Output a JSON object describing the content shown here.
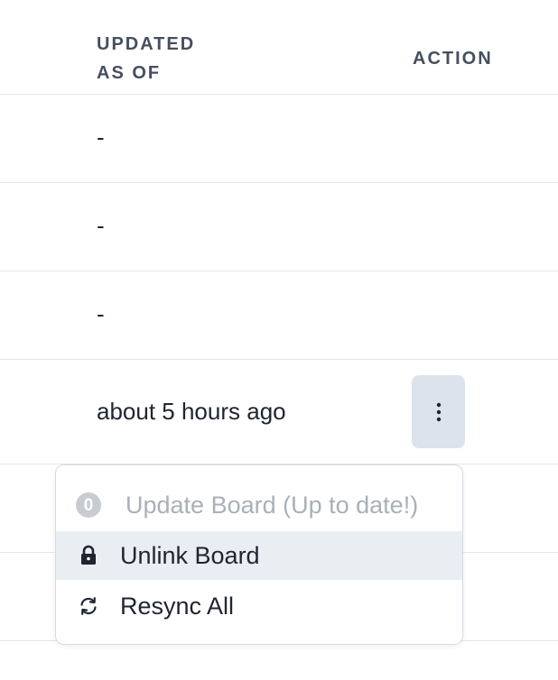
{
  "table": {
    "headers": {
      "updated_line1": "UPDATED",
      "updated_line2": "AS OF",
      "action": "ACTION"
    },
    "rows": [
      {
        "updated": "-"
      },
      {
        "updated": "-"
      },
      {
        "updated": "-"
      },
      {
        "updated": "about 5 hours ago",
        "has_action": true
      }
    ]
  },
  "menu": {
    "items": [
      {
        "label": "Update Board (Up to date!)",
        "icon": "zero-count-badge",
        "badge": "0",
        "disabled": true
      },
      {
        "label": "Unlink Board",
        "icon": "lock-icon",
        "highlighted": true
      },
      {
        "label": "Resync All",
        "icon": "refresh-icon"
      }
    ]
  },
  "colors": {
    "header_text": "#454f5e",
    "body_text": "#1f2530",
    "divider": "#e3e6ea",
    "kebab_bg": "#dde3ec",
    "menu_highlight": "#e9eef3",
    "disabled_text": "#aab0b8"
  }
}
